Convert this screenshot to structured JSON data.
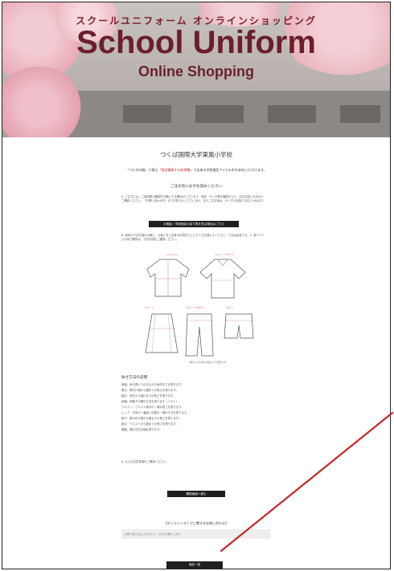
{
  "hero": {
    "kana_title": "スクールユニフォーム オンラインショッピング",
    "title": "School Uniform",
    "subtitle": "Online Shopping"
  },
  "main": {
    "school_name": "つくば国際大学東風小学校",
    "intro_prefix": "「ベル付の服」で表示",
    "intro_highlight": "「指定購買する新規購」",
    "intro_suffix": "で出来る学校指定アイテムをお求めいただけます。",
    "notice_heading": "ご注文前に必ずお読みください",
    "notice_text": "A. ご注文には、ご指定数の確認をお願いする場合がございます。商品・サイズ等を確認のうえ、お注文前にお手元へご確認ください。「お問い合わせ先」までお知らせくださいませ。またご注文後は、サイズの交換にお応じかねます。",
    "size_guide_button": "お電話・学校指定の採寸表を見る場合はこちら",
    "size_note": "B. 身体の寸法を図れる様に、お客さまご自身の計測をもとにサイズを選んでください。寸法は目安です。C. 各アイテムの採寸箇所は、下記の図をご確認ください。",
    "garments": [
      {
        "label": "ジャケット"
      },
      {
        "label": "シャツ・ブラウス"
      },
      {
        "label": "スカート"
      },
      {
        "label": "ズボン・半ズボン"
      },
      {
        "label": "ズボン"
      }
    ],
    "figure_caption": "※各サイズの測り方はあくまで目安です",
    "measure_heading": "採寸方法の説明",
    "measure_lines": [
      "肩幅：後ろ襟ぐりの中心から肩先までを測ります。",
      "着丈：襟付け根から裾までの長さを測ります。",
      "袖丈：肩先から袖口までの長さを測ります。",
      "身幅：両脇下の間の寸法を測ります（バスト）。",
      "ウエスト：ウエスト部分の一周の長さを測ります。",
      "ヒップ：お尻の一番高い位置の一周の寸法を測ります。",
      "股下：股の付け根から裾までの長さを測ります。",
      "総丈：ウエストから裾までの長さを測ります。",
      "裾幅：裾の左右の幅を測ります。"
    ],
    "measure_footer": "A. 以上の注意事項をご確認ください。",
    "confirm_button": "確認画面へ進む",
    "contact_heading": "【オンラインストアに関するお問い合わせ】",
    "contact_text": "お問い合わせはこちらのフォームからお願いします",
    "bottom_button": "商品一覧"
  },
  "colors": {
    "accent": "#6b1f2b",
    "button": "#1f1f1f",
    "annotation_arrow": "#c62828"
  }
}
